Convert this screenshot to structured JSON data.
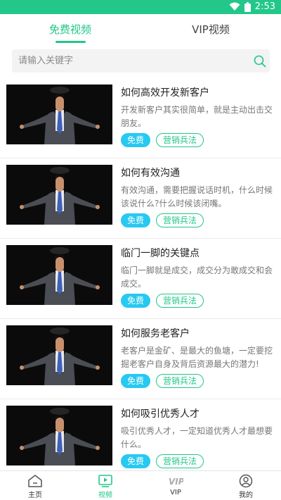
{
  "status_bar": {
    "time": "2:53",
    "icons": [
      "wifi-icon",
      "battery-icon"
    ]
  },
  "tabs": [
    {
      "label": "免费视频",
      "active": true
    },
    {
      "label": "VIP视频",
      "active": false
    }
  ],
  "search": {
    "placeholder": "请输入关键字",
    "icon": "search-icon"
  },
  "videos": [
    {
      "title": "如何高效开发新客户",
      "desc": "开发新客户其实很简单，就是主动出击交朋友。",
      "badge": "免费",
      "category": "营销兵法"
    },
    {
      "title": "如何有效沟通",
      "desc": "有效沟通，需要把握说话时机，什么时候该说什么?什么时候该闭嘴。",
      "badge": "免费",
      "category": "营销兵法"
    },
    {
      "title": "临门一脚的关键点",
      "desc": "临门一脚就是成交，成交分为敢成交和会成交。",
      "badge": "免费",
      "category": "营销兵法"
    },
    {
      "title": "如何服务老客户",
      "desc": "老客户是金矿、是最大的鱼塘，一定要挖掘老客户自身及背后资源最大的潜力!",
      "badge": "免费",
      "category": "营销兵法"
    },
    {
      "title": "如何吸引优秀人才",
      "desc": "吸引优秀人才，一定知道优秀人才最想要什么。",
      "badge": "免费",
      "category": "营销兵法"
    }
  ],
  "bottom_nav": [
    {
      "label": "主页",
      "icon": "home-icon",
      "active": false
    },
    {
      "label": "视频",
      "icon": "video-icon",
      "active": true
    },
    {
      "label": "VIP",
      "icon": "vip-icon",
      "active": false
    },
    {
      "label": "我的",
      "icon": "profile-icon",
      "active": false
    }
  ],
  "colors": {
    "accent": "#22c789",
    "free_badge": "#27c9f0"
  }
}
